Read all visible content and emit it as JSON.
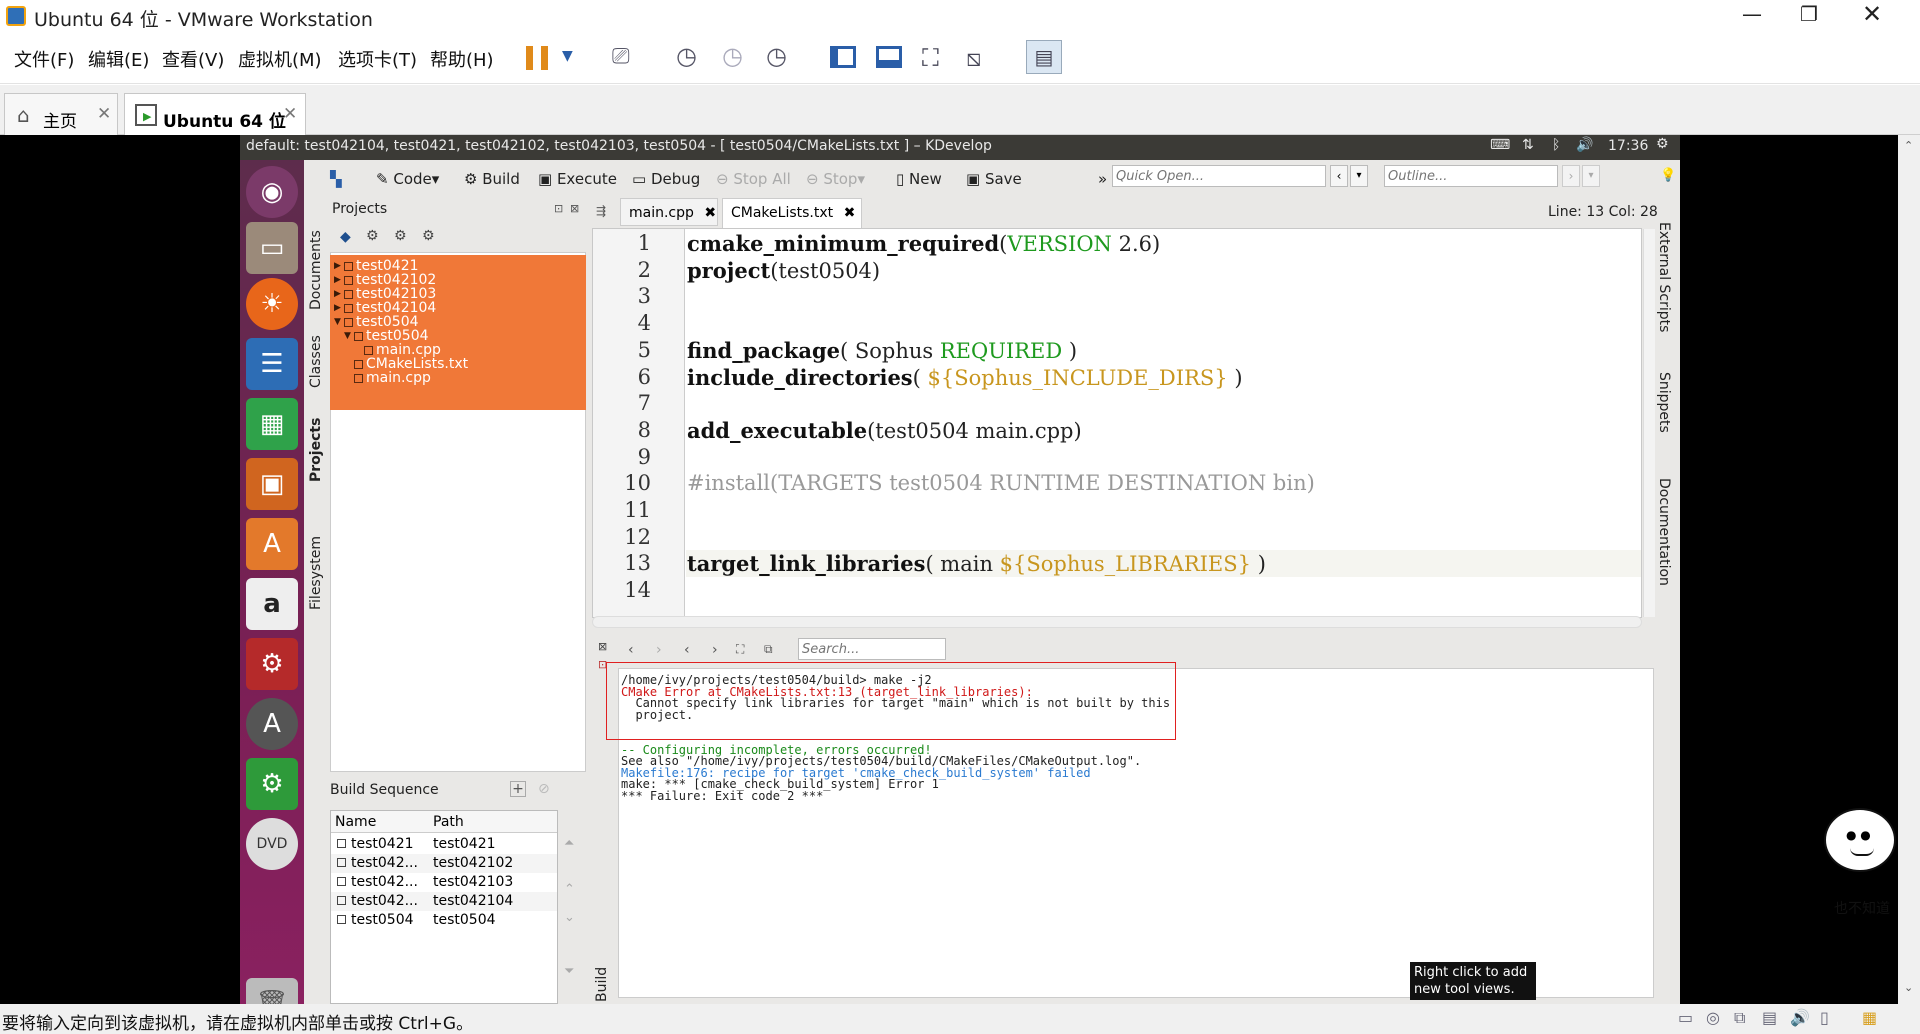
{
  "vmware": {
    "window_title": "Ubuntu 64 位 - VMware Workstation",
    "menu": [
      "文件(F)",
      "编辑(E)",
      "查看(V)",
      "虚拟机(M)",
      "选项卡(T)",
      "帮助(H)"
    ],
    "tabs": [
      {
        "label": "主页"
      },
      {
        "label": "Ubuntu 64 位"
      }
    ],
    "status_text": "要将输入定向到该虚拟机，请在虚拟机内部单击或按 Ctrl+G。"
  },
  "ubuntu_panel": {
    "title": "default:  test042104, test0421, test042102, test042103, test0504 - [ test0504/CMakeLists.txt ] – KDevelop",
    "clock": "17:36"
  },
  "toolbar": {
    "code": "Code",
    "build": "Build",
    "execute": "Execute",
    "debug": "Debug",
    "stop_all": "Stop All",
    "stop": "Stop",
    "new": "New",
    "save": "Save",
    "quick_open_placeholder": "Quick Open...",
    "outline_placeholder": "Outline...",
    "more": "»"
  },
  "left_tabs": [
    "Documents",
    "Classes",
    "Projects",
    "Filesystem"
  ],
  "right_tabs": [
    "External Scripts",
    "Snippets",
    "Documentation"
  ],
  "projects_panel": {
    "title": "Projects",
    "tree": [
      {
        "label": "test0421",
        "level": 0,
        "expanded": false
      },
      {
        "label": "test042102",
        "level": 0,
        "expanded": false
      },
      {
        "label": "test042103",
        "level": 0,
        "expanded": false
      },
      {
        "label": "test042104",
        "level": 0,
        "expanded": false
      },
      {
        "label": "test0504",
        "level": 0,
        "expanded": true
      },
      {
        "label": "test0504",
        "level": 1,
        "expanded": true
      },
      {
        "label": "main.cpp",
        "level": 2
      },
      {
        "label": "CMakeLists.txt",
        "level": 1
      },
      {
        "label": "main.cpp",
        "level": 1
      }
    ]
  },
  "build_sequence": {
    "title": "Build Sequence",
    "columns": [
      "Name",
      "Path"
    ],
    "rows": [
      [
        "test0421",
        "test0421"
      ],
      [
        "test042...",
        "test042102"
      ],
      [
        "test042...",
        "test042103"
      ],
      [
        "test042...",
        "test042104"
      ],
      [
        "test0504",
        "test0504"
      ]
    ],
    "side_label": "Build"
  },
  "editor": {
    "tabs": [
      {
        "label": "main.cpp"
      },
      {
        "label": "CMakeLists.txt"
      }
    ],
    "position": "Line: 13 Col: 28",
    "lines": [
      {
        "n": "1",
        "parts": [
          [
            "kw",
            "cmake_minimum_required"
          ],
          [
            "",
            "("
          ],
          [
            "gr",
            "VERSION"
          ],
          [
            "",
            " 2.6)"
          ]
        ]
      },
      {
        "n": "2",
        "parts": [
          [
            "kw",
            "project"
          ],
          [
            "",
            "(test0504)"
          ]
        ]
      },
      {
        "n": "3",
        "parts": []
      },
      {
        "n": "4",
        "parts": []
      },
      {
        "n": "5",
        "parts": [
          [
            "kw",
            "find_package"
          ],
          [
            "",
            "( Sophus "
          ],
          [
            "gr",
            "REQUIRED"
          ],
          [
            "",
            " )"
          ]
        ]
      },
      {
        "n": "6",
        "parts": [
          [
            "kw",
            "include_directories"
          ],
          [
            "",
            "( "
          ],
          [
            "or",
            "${Sophus_INCLUDE_DIRS}"
          ],
          [
            "",
            " )"
          ]
        ]
      },
      {
        "n": "7",
        "parts": []
      },
      {
        "n": "8",
        "parts": [
          [
            "kw",
            "add_executable"
          ],
          [
            "",
            "(test0504 main.cpp)"
          ]
        ]
      },
      {
        "n": "9",
        "parts": []
      },
      {
        "n": "10",
        "parts": [
          [
            "cm",
            "#install(TARGETS test0504 RUNTIME DESTINATION bin)"
          ]
        ]
      },
      {
        "n": "11",
        "parts": []
      },
      {
        "n": "12",
        "parts": []
      },
      {
        "n": "13",
        "parts": [
          [
            "kw",
            "target_link_libraries"
          ],
          [
            "",
            "( main "
          ],
          [
            "or",
            "${Sophus_LIBRARIES}"
          ],
          [
            "",
            " )"
          ]
        ]
      },
      {
        "n": "14",
        "parts": []
      }
    ]
  },
  "output": {
    "search_placeholder": "Search...",
    "lines": [
      {
        "cls": "",
        "text": "/home/ivy/projects/test0504/build> make -j2"
      },
      {
        "cls": "red",
        "text": "CMake Error at CMakeLists.txt:13 (target_link_libraries):"
      },
      {
        "cls": "",
        "text": "  Cannot specify link libraries for target \"main\" which is not built by this"
      },
      {
        "cls": "",
        "text": "  project."
      },
      {
        "cls": "",
        "text": ""
      },
      {
        "cls": "",
        "text": ""
      },
      {
        "cls": "grn",
        "text": "-- Configuring incomplete, errors occurred!"
      },
      {
        "cls": "",
        "text": "See also \"/home/ivy/projects/test0504/build/CMakeFiles/CMakeOutput.log\"."
      },
      {
        "cls": "blu",
        "text": "Makefile:176: recipe for target 'cmake_check_build_system' failed"
      },
      {
        "cls": "",
        "text": "make: *** [cmake_check_build_system] Error 1"
      },
      {
        "cls": "",
        "text": "*** Failure: Exit code 2 ***"
      }
    ]
  },
  "tooltip": {
    "line1": "Right click to add",
    "line2": "new tool views."
  },
  "sticker_text": "也不知道"
}
